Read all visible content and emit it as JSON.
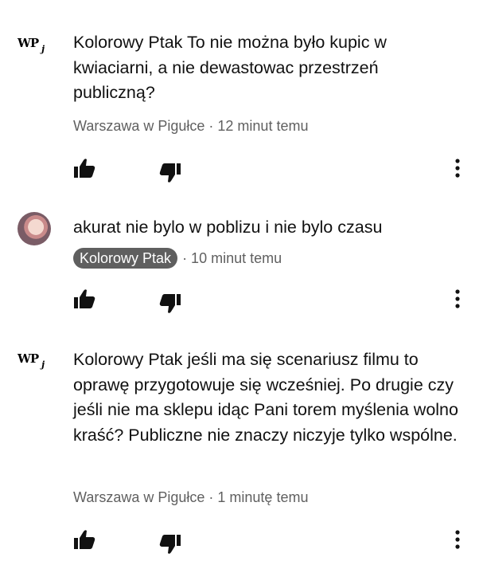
{
  "comments": [
    {
      "avatar_label": "WP",
      "text": "Kolorowy Ptak  To nie można było kupic w kwiaciarni, a nie dewastowac przestrzeń publiczną?",
      "author": "Warszawa w Pigułce",
      "time": "· 12 minut temu"
    },
    {
      "text": "akurat nie bylo w poblizu i nie bylo czasu",
      "author": "Kolorowy Ptak",
      "time": "· 10 minut temu"
    },
    {
      "avatar_label": "WP",
      "text": "Kolorowy Ptak jeśli ma się scenariusz filmu to oprawę przygotowuje się wcześniej. Po drugie czy jeśli nie ma sklepu idąc Pani torem myślenia wolno kraść? Publiczne nie znaczy niczyje tylko wspólne.",
      "author": "Warszawa w Pigułce",
      "time": "· 1 minutę temu"
    }
  ],
  "icons": {
    "like": "thumbs-up-icon",
    "dislike": "thumbs-down-icon",
    "more": "more-vert-icon"
  }
}
